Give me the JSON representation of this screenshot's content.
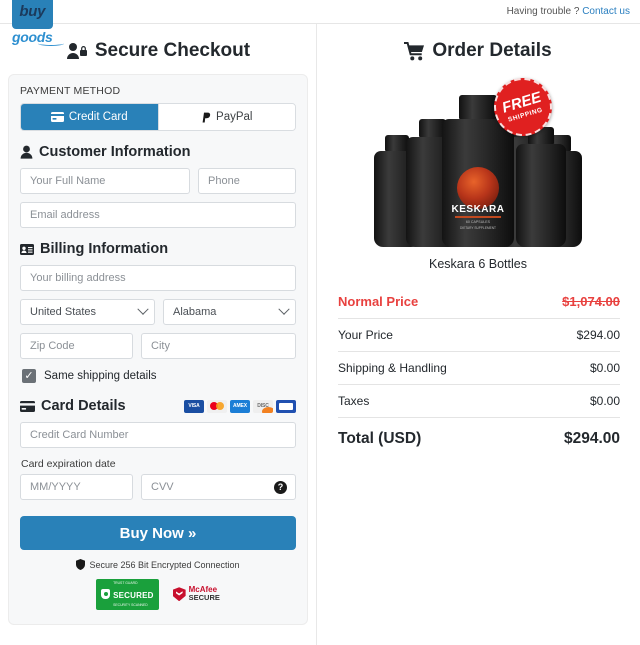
{
  "topbar": {
    "logo_buy": "buy",
    "logo_goods": "goods",
    "trouble_text": "Having trouble ?",
    "contact_link": "Contact us"
  },
  "checkout": {
    "title": "Secure Checkout",
    "payment_method_label": "PAYMENT METHOD",
    "tabs": [
      {
        "label": "Credit Card",
        "active": true
      },
      {
        "label": "PayPal",
        "active": false
      }
    ],
    "customer_info": {
      "title": "Customer Information",
      "full_name_placeholder": "Your Full Name",
      "phone_placeholder": "Phone",
      "email_placeholder": "Email address"
    },
    "billing_info": {
      "title": "Billing Information",
      "address_placeholder": "Your billing address",
      "country_value": "United States",
      "state_value": "Alabama",
      "zip_placeholder": "Zip Code",
      "city_placeholder": "City",
      "same_shipping_label": "Same shipping details",
      "same_shipping_checked": true
    },
    "card_details": {
      "title": "Card Details",
      "card_number_placeholder": "Credit Card Number",
      "expiration_label": "Card expiration date",
      "mmyyyy_placeholder": "MM/YYYY",
      "cvv_placeholder": "CVV",
      "accepted_cards": [
        "visa",
        "mastercard",
        "amex",
        "discover",
        "generic-card"
      ]
    },
    "buy_button": "Buy Now »",
    "secure_note": "Secure 256 Bit Encrypted Connection",
    "badges": [
      {
        "name": "secured-badge",
        "top": "TRUST GUARD",
        "main": "SECURED",
        "bottom": "SECURITY SCANNED"
      },
      {
        "name": "mcafee-badge",
        "line1": "McAfee",
        "line2": "SECURE"
      }
    ]
  },
  "order": {
    "title": "Order Details",
    "free_shipping_line1": "FREE",
    "free_shipping_line2": "SHIPPING",
    "product_label_brand": "KESKARA",
    "product_label_sub": "60 CAPSULES",
    "product_label_foot": "DIETARY SUPPLEMENT",
    "product_name": "Keskara 6 Bottles",
    "rows": [
      {
        "label": "Normal Price",
        "value": "$1,074.00",
        "style": "normal"
      },
      {
        "label": "Your Price",
        "value": "$294.00",
        "style": "plain"
      },
      {
        "label": "Shipping & Handling",
        "value": "$0.00",
        "style": "plain"
      },
      {
        "label": "Taxes",
        "value": "$0.00",
        "style": "plain"
      },
      {
        "label": "Total (USD)",
        "value": "$294.00",
        "style": "total"
      }
    ]
  },
  "colors": {
    "accent_blue": "#2981b8",
    "link_blue": "#2a7fc0",
    "price_red": "#e8413f",
    "panel_bg": "#f7f8f9"
  }
}
